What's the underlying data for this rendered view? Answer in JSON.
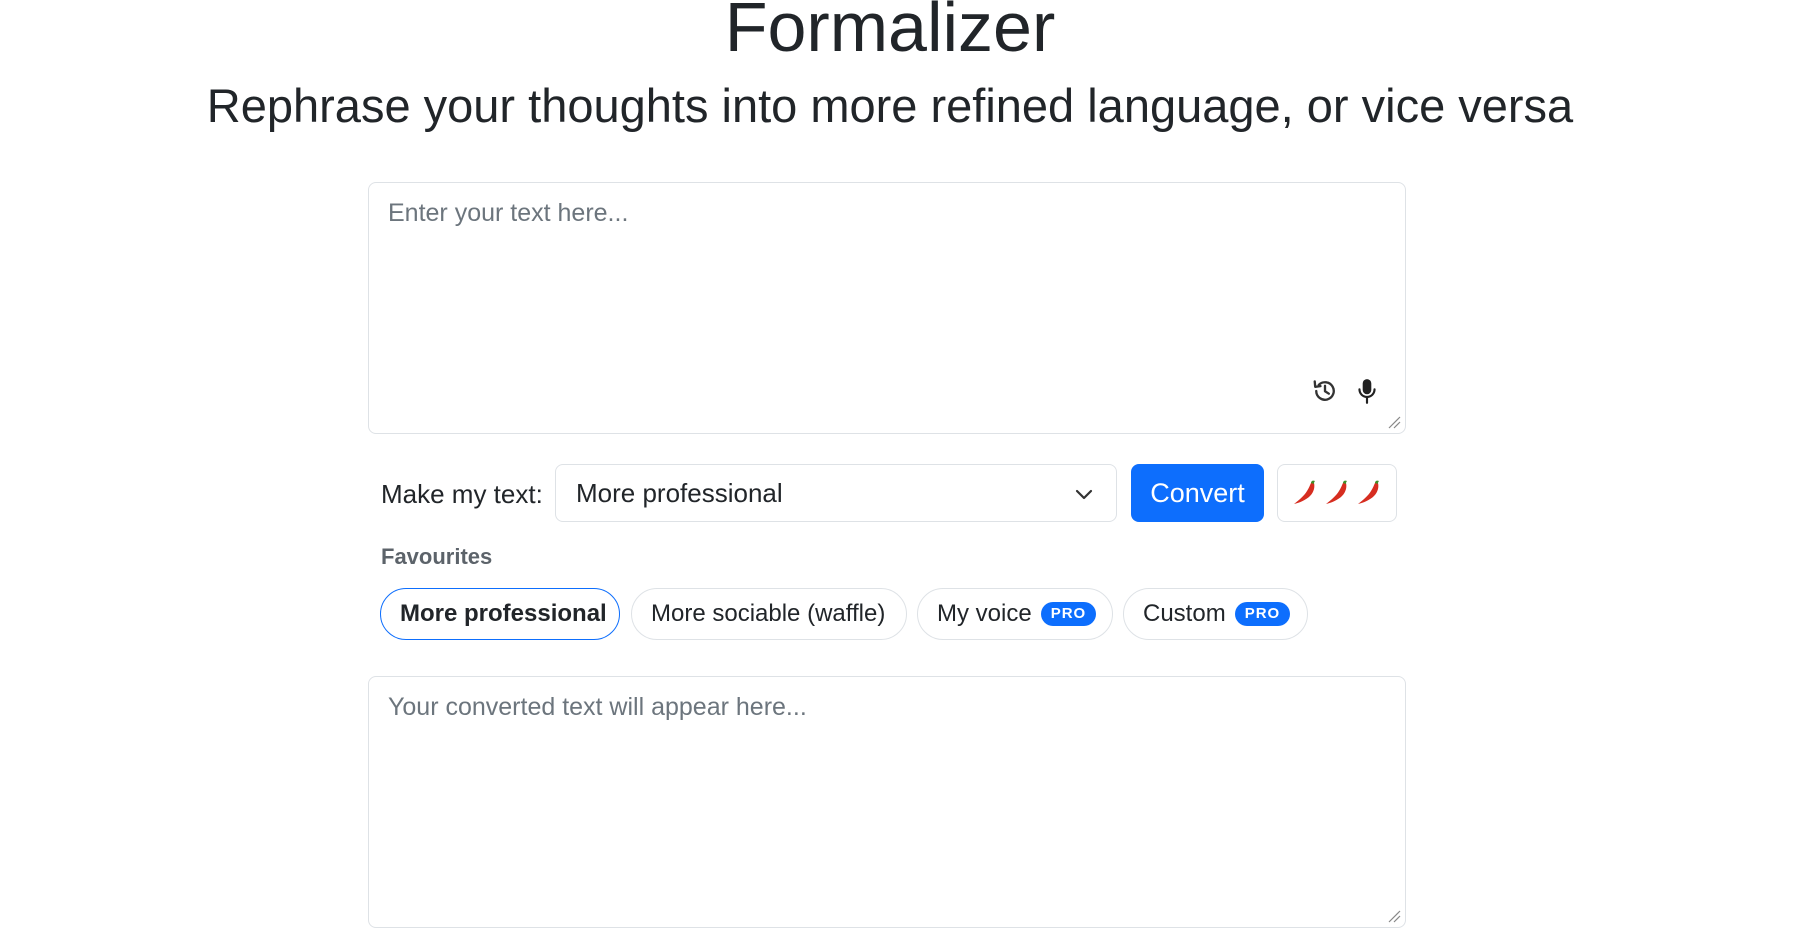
{
  "header": {
    "title": "Formalizer",
    "subtitle": "Rephrase your thoughts into more refined language, or vice versa"
  },
  "input": {
    "placeholder": "Enter your text here...",
    "value": "",
    "icons": [
      "history-icon",
      "microphone-icon"
    ]
  },
  "controls": {
    "make_label": "Make my text:",
    "selected_mode": "More professional",
    "convert_label": "Convert",
    "spice_label": "🌶️🌶️🌶️",
    "spice_icon": "chili-pepper-icon",
    "spice_level": 3
  },
  "favourites": {
    "heading": "Favourites",
    "items": [
      {
        "label": "More professional",
        "active": true,
        "badge": ""
      },
      {
        "label": "More sociable (waffle)",
        "active": false,
        "badge": ""
      },
      {
        "label": "My voice",
        "active": false,
        "badge": "PRO"
      },
      {
        "label": "Custom",
        "active": false,
        "badge": "PRO"
      }
    ]
  },
  "output": {
    "placeholder": "Your converted text will appear here...",
    "value": ""
  },
  "colors": {
    "accent": "#0d6efd",
    "border": "#dee2e6",
    "text": "#212529",
    "muted": "#6c757d",
    "chili_red": "#d62d20",
    "chili_green": "#3f8f29"
  }
}
